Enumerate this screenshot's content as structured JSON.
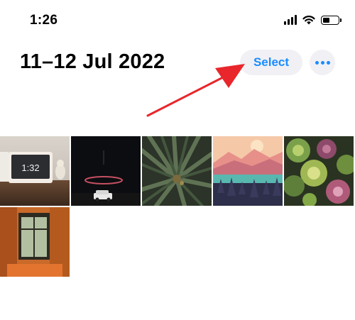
{
  "status_bar": {
    "time": "1:26",
    "icons": [
      "cellular-signal-icon",
      "wifi-icon",
      "battery-icon"
    ]
  },
  "header": {
    "title": "11–12 Jul 2022",
    "select_label": "Select",
    "more_icon": "ellipsis-icon"
  },
  "annotation": {
    "arrow_color": "#e8262b"
  },
  "grid": {
    "photos": [
      {
        "subject": "smart display clock",
        "clock_text": "1:32"
      },
      {
        "subject": "car under light ring at night"
      },
      {
        "subject": "palm fronds"
      },
      {
        "subject": "illustrated mountain sunset landscape"
      },
      {
        "subject": "succulent plants"
      },
      {
        "subject": "window with orange walls"
      }
    ]
  },
  "colors": {
    "accent": "#1a8cff",
    "button_bg": "#f0f0f5",
    "arrow": "#e8262b"
  }
}
